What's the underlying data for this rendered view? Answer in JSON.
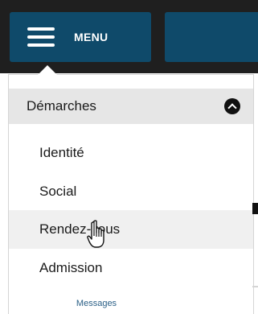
{
  "header": {
    "menu_label": "MENU"
  },
  "dropdown": {
    "section_label": "Démarches",
    "items": [
      {
        "label": "Identité"
      },
      {
        "label": "Social"
      },
      {
        "label": "Rendez-vous"
      },
      {
        "label": "Admission"
      }
    ]
  },
  "footer": {
    "label": "Messages"
  },
  "colors": {
    "accent": "#0f4a6a",
    "header_bg": "#e6e6e6",
    "hover_bg": "#f0f0f0"
  },
  "icons": [
    "hamburger-icon",
    "chevron-up-icon",
    "hand-cursor-icon"
  ]
}
